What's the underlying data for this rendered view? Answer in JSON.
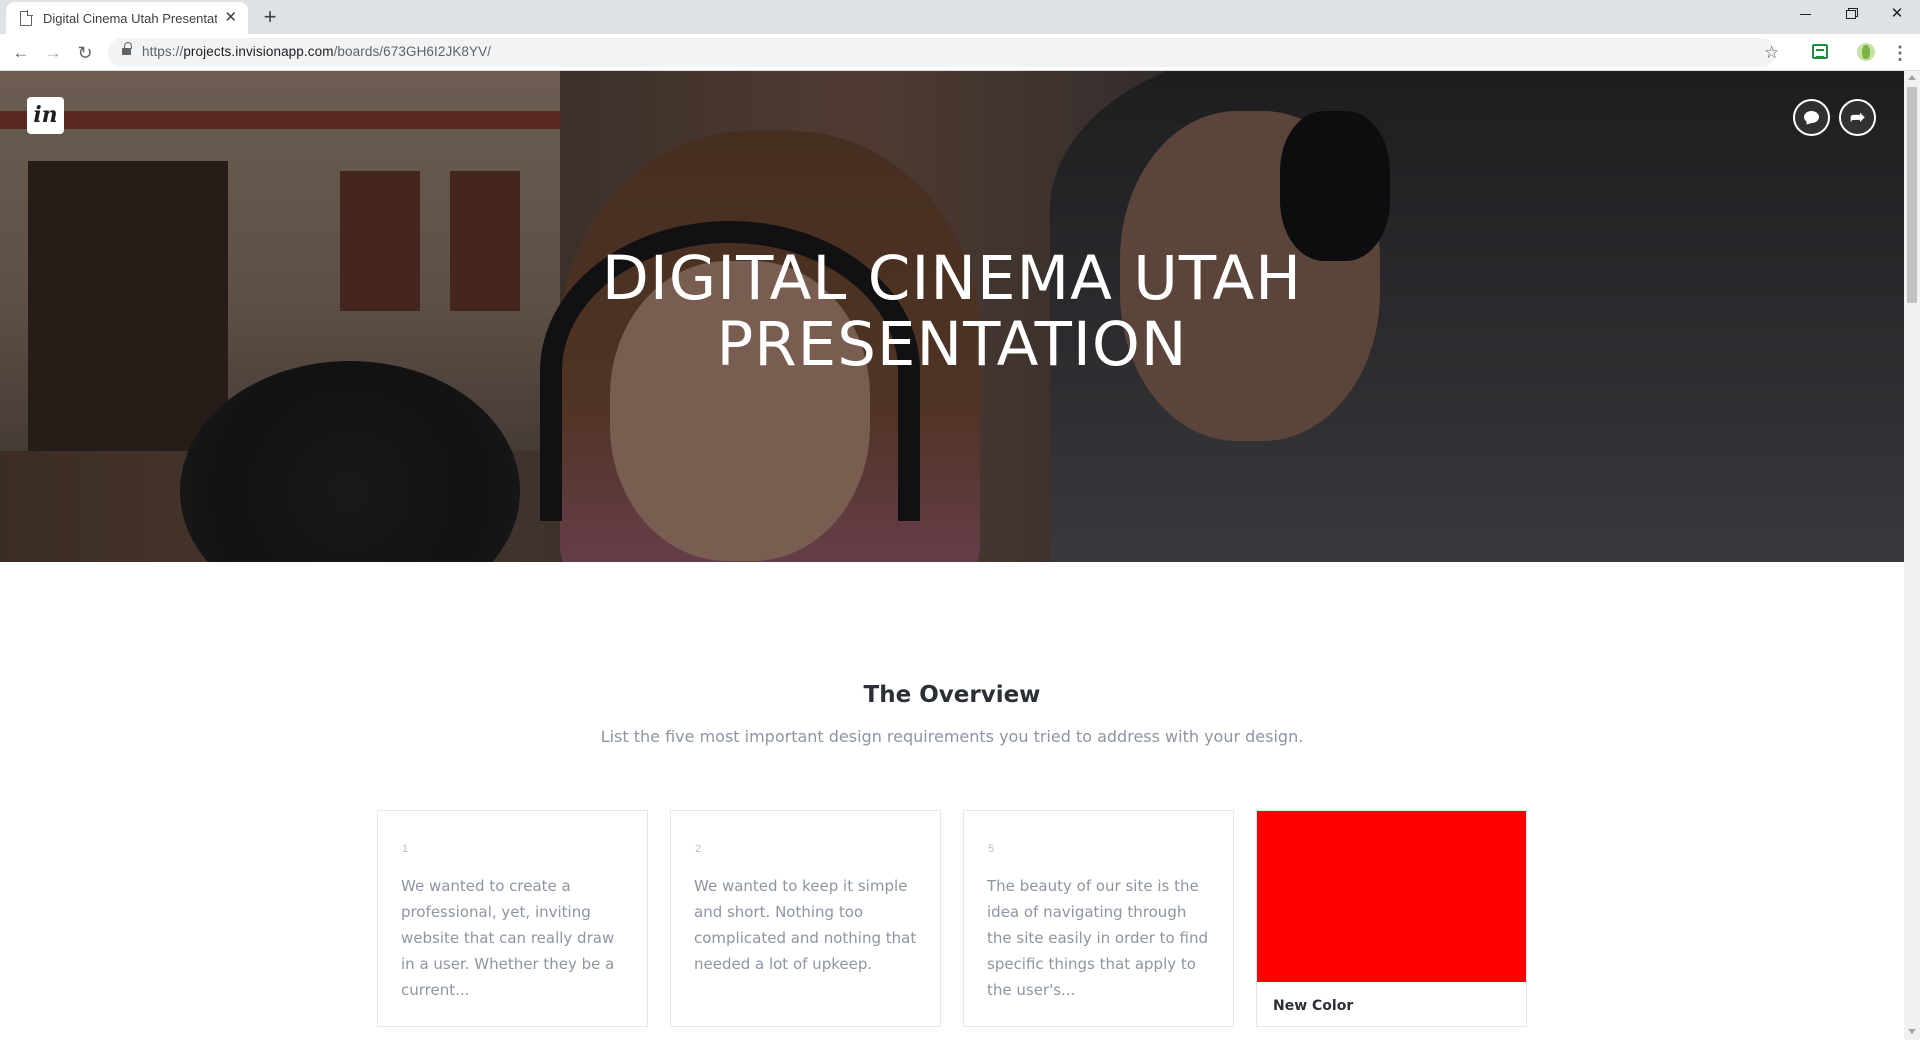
{
  "browser": {
    "tab_title": "Digital Cinema Utah Presentation",
    "tab_close": "✕",
    "new_tab": "+",
    "url_prefix": "https://",
    "url_host": "projects.invisionapp.com",
    "url_path": "/boards/673GH6I2JK8YV/",
    "back": "←",
    "forward": "→",
    "reload": "↻",
    "star": "☆",
    "menu": "⋮",
    "close": "✕"
  },
  "hero": {
    "logo_text": "in",
    "title_line1": "DIGITAL CINEMA UTAH",
    "title_line2": "PRESENTATION",
    "share_glyph": "➦"
  },
  "overview": {
    "title": "The Overview",
    "subtitle": "List the five most important design requirements you tried to address with your design."
  },
  "cards": [
    {
      "number": "1",
      "text": "We wanted to create a professional, yet, inviting website that can really draw in a user. Whether they be a current..."
    },
    {
      "number": "2",
      "text": "We wanted to keep it simple and short. Nothing too complicated and nothing that needed a lot of upkeep."
    },
    {
      "number": "5",
      "text": "The beauty of our site is the idea of navigating through the site easily in order to find specific things that apply to the user's..."
    }
  ],
  "color_card": {
    "label": "New Color",
    "color": "#ff0000"
  },
  "colors": {
    "accent": "#ff0000",
    "text_dark": "#2b2f36",
    "text_muted": "#8c96a3"
  }
}
